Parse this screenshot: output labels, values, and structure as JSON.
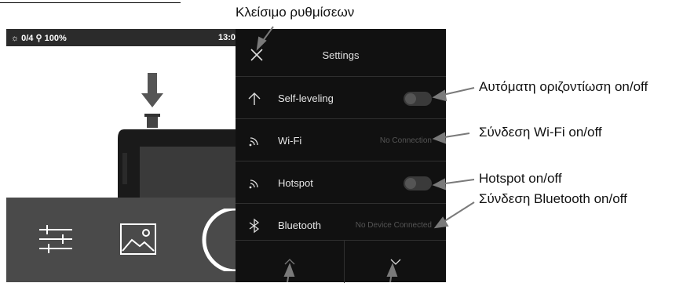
{
  "annotations": {
    "close_settings": "Κλείσιμο ρυθμίσεων",
    "self_leveling": "Αυτόματη οριζοντίωση on/off",
    "wifi": "Σύνδεση Wi-Fi on/off",
    "hotspot": "Hotspot on/off",
    "bluetooth": "Σύνδεση Bluetooth on/off"
  },
  "status_bar": {
    "indicators": "☼ 0/4  ⚲ 100%",
    "time": "13:0"
  },
  "settings": {
    "title": "Settings",
    "rows": [
      {
        "label": "Self-leveling",
        "icon": "arrow-up-icon",
        "control": "toggle",
        "state": "off"
      },
      {
        "label": "Wi-Fi",
        "icon": "wifi-icon",
        "status": "No Connection"
      },
      {
        "label": "Hotspot",
        "icon": "hotspot-icon",
        "control": "toggle",
        "state": "off"
      },
      {
        "label": "Bluetooth",
        "icon": "bluetooth-icon",
        "status": "No Device Connected"
      }
    ]
  },
  "bottom_toolbar": {
    "icons": [
      "sliders-icon",
      "image-icon",
      "shutter-button"
    ]
  },
  "colors": {
    "panel_bg": "#111111",
    "divider": "#303030",
    "toolbar_bg": "#4a4a4a",
    "callout_arrow": "#7a7a7a"
  }
}
